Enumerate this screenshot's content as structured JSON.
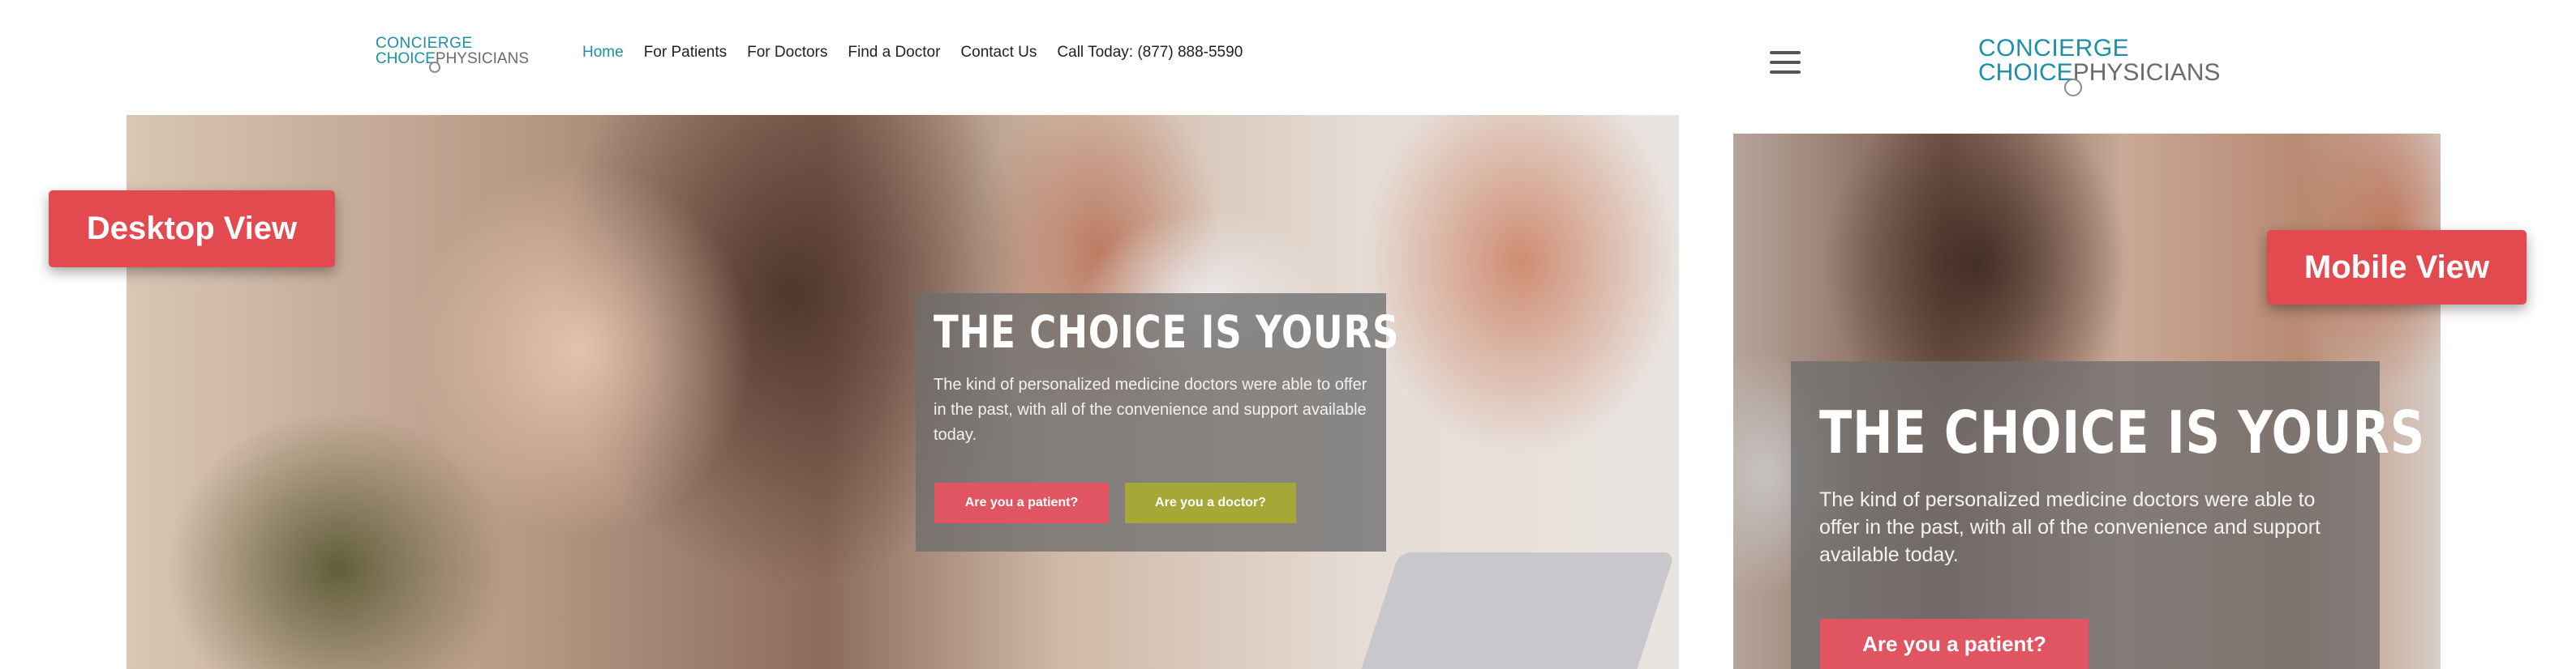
{
  "desktop": {
    "logo": {
      "line1": "CONCIERGE",
      "line2a": "CHOICE",
      "line2b": "PHYSICIANS"
    },
    "nav": {
      "items": [
        {
          "label": "Home",
          "active": true
        },
        {
          "label": "For Patients",
          "active": false
        },
        {
          "label": "For Doctors",
          "active": false
        },
        {
          "label": "Find a Doctor",
          "active": false
        },
        {
          "label": "Contact Us",
          "active": false
        },
        {
          "label": "Call Today: (877) 888-5590",
          "active": false
        }
      ]
    },
    "hero": {
      "title": "THE CHOICE IS YOURS",
      "text": "The kind of personalized medicine doctors were able to offer in the past, with all of the convenience and support available today.",
      "patient_button": "Are you a patient?",
      "doctor_button": "Are you a doctor?"
    },
    "label": "Desktop View"
  },
  "mobile": {
    "logo": {
      "line1": "CONCIERGE",
      "line2a": "CHOICE",
      "line2b": "PHYSICIANS"
    },
    "hero": {
      "title": "THE CHOICE IS YOURS",
      "text": "The kind of personalized medicine doctors were able to offer in the past, with all of the convenience and support available today.",
      "patient_button": "Are you a patient?"
    },
    "label": "Mobile View"
  },
  "colors": {
    "brand_teal": "#1d8fa8",
    "patient_button": "#e05561",
    "doctor_button": "#a5a836",
    "label_pill": "#e24a4f"
  },
  "icons": {
    "menu": "hamburger-menu-icon"
  }
}
